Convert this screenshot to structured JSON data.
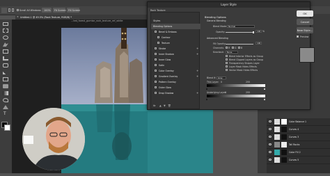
{
  "topbar": {
    "options": [
      "Scroll All Windows",
      "100%",
      "Fit Screen",
      "Fill Screen"
    ]
  },
  "document_tab": "Untitled-1 @ 49.5% (Rock Texture, RGB/8) *",
  "canvas_label": "...ted_forest_gumtor_rock_texture_ref_white",
  "dialog": {
    "title": "Layer Style",
    "style_preset": "Rock Texture",
    "styles_header": "Styles",
    "styles": [
      {
        "label": "Blending Options",
        "selected": true,
        "checkbox": false,
        "plus": false
      },
      {
        "label": "Bevel & Emboss",
        "checkbox": true,
        "plus": false
      },
      {
        "label": "Contour",
        "checkbox": true,
        "plus": false,
        "indent": true
      },
      {
        "label": "Texture",
        "checkbox": true,
        "plus": false,
        "indent": true
      },
      {
        "label": "Stroke",
        "checkbox": true,
        "plus": true
      },
      {
        "label": "Inner Shadow",
        "checkbox": true,
        "plus": true
      },
      {
        "label": "Inner Glow",
        "checkbox": true,
        "plus": false
      },
      {
        "label": "Satin",
        "checkbox": true,
        "plus": false
      },
      {
        "label": "Color Overlay",
        "checkbox": true,
        "plus": true
      },
      {
        "label": "Gradient Overlay",
        "checkbox": true,
        "plus": true
      },
      {
        "label": "Pattern Overlay",
        "checkbox": true,
        "plus": false
      },
      {
        "label": "Outer Glow",
        "checkbox": true,
        "plus": false
      },
      {
        "label": "Drop Shadow",
        "checkbox": true,
        "plus": true
      }
    ],
    "fx_label": "fx",
    "blending_options": {
      "header": "Blending Options",
      "general_header": "General Blending",
      "blend_mode_label": "Blend Mode:",
      "blend_mode_value": "Normal",
      "opacity_label": "Opacity:",
      "opacity_value": "100",
      "opacity_unit": "%",
      "advanced_header": "Advanced Blending",
      "fill_opacity_label": "Fill Opacity:",
      "fill_opacity_value": "100",
      "channels_label": "Channels:",
      "channels": [
        "R",
        "G",
        "B"
      ],
      "knockout_label": "Knockout:",
      "knockout_value": "None",
      "checkboxes": [
        "Blend Interior Effects as Group",
        "Blend Clipped Layers as Group",
        "Transparency Shapes Layer",
        "Layer Mask Hides Effects",
        "Vector Mask Hides Effects"
      ],
      "blend_if_label": "Blend If:",
      "blend_if_value": "Gray",
      "this_layer_label": "This Layer:",
      "this_layer_min": "0",
      "this_layer_max": "255",
      "underlying_label": "Underlying Layer:",
      "underlying_min": "0",
      "underlying_max": "255"
    },
    "buttons": {
      "ok": "OK",
      "cancel": "Cancel",
      "new_style": "New Style...",
      "preview": "Preview"
    }
  },
  "layers": [
    {
      "name": "Color Balance 1",
      "thumb": "#ddd",
      "mask": "#fff"
    },
    {
      "name": "Curves 4",
      "thumb": "#ddd",
      "mask": "#111"
    },
    {
      "name": "Curves 3",
      "thumb": "#ddd",
      "mask": "#111"
    },
    {
      "name": "Tall Rocks",
      "thumb": "#888",
      "mask": "#eee"
    },
    {
      "name": "Color Fill 2",
      "thumb": "#3aa",
      "mask": "#111"
    },
    {
      "name": "Curves 5",
      "thumb": "#ddd",
      "mask": "#111"
    }
  ]
}
